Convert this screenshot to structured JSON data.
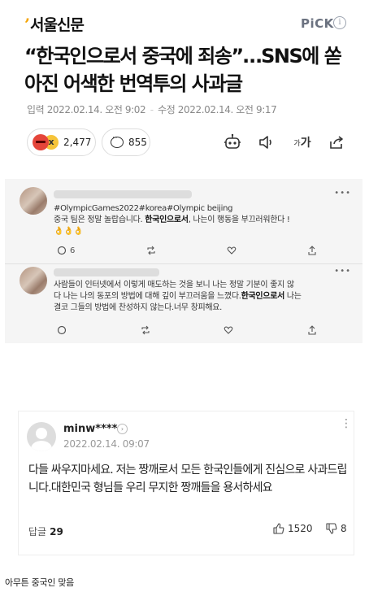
{
  "header": {
    "logo_mark": "’",
    "logo_text": "서울신문",
    "pick_label": "PiCK",
    "info_glyph": "i"
  },
  "article": {
    "headline": "“한국인으로서 중국에 죄송”…SNS에 쏟아진 어색한 번역투의 사과글",
    "input_date": "입력 2022.02.14. 오전 9:02",
    "separator": "-",
    "edit_date": "수정 2022.02.14. 오전 9:17",
    "reaction_count": "2,477",
    "reaction_x": "x",
    "comment_count": "855",
    "font_tool_small": "가",
    "font_tool_big": "가"
  },
  "tweets": [
    {
      "more": "•••",
      "line1": "#OlympicGames2022#korea#Olympic beijing",
      "line2_pre": "중국 팀은 정말 놀랍습니다. ",
      "line2_bold": "한국인으로서",
      "line2_post": ", 나는이 행동을 부끄러워한다 !",
      "line3": "👌👌👌",
      "reply_count": "6"
    },
    {
      "more": "•••",
      "line1": "사람들이 인터넷에서 이렇게 매도하는 것을 보니 나는 정말 기분이 좋지 않",
      "line2_pre": "다 나는 나의 동포의 방법에 대해 깊이 부끄러움을 느꼈다.",
      "line2_bold": "한국인으로서",
      "line2_post": " 나는",
      "line3": "결코 그들의 방법에 찬성하지 않는다.너무 창피해요."
    }
  ],
  "comment": {
    "username": "minw****",
    "chevron": "›",
    "date": "2022.02.14. 09:07",
    "more": "⋮",
    "text": "다들 싸우지마세요. 저는 짱깨로서 모든 한국인들에게 진심으로 사과드립니다.대한민국 형님들 우리 무지한 짱깨들을 용서하세요",
    "replies_label": "답글",
    "replies_count": "29",
    "likes": "1520",
    "dislikes": "8"
  },
  "caption": "아무튼 중국인 맞음"
}
